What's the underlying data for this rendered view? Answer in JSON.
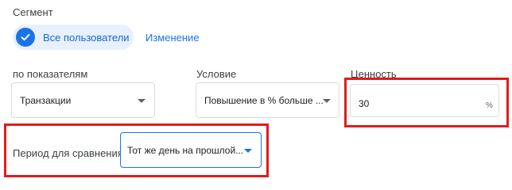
{
  "segment": {
    "label": "Сегмент",
    "chip_label": "Все пользователи",
    "change_link": "Изменение"
  },
  "metric": {
    "label": "по показателям",
    "value": "Транзакции"
  },
  "condition": {
    "label": "Условие",
    "value": "Повышение в % больше ..."
  },
  "value_field": {
    "label": "Ценность",
    "value": "30",
    "unit": "%"
  },
  "comparison": {
    "label": "Период для сравнения",
    "value": "Тот же день на прошлой..."
  },
  "colors": {
    "accent": "#1a73e8",
    "chip_bg": "#e8f0fe",
    "highlight": "#e21b1b"
  }
}
